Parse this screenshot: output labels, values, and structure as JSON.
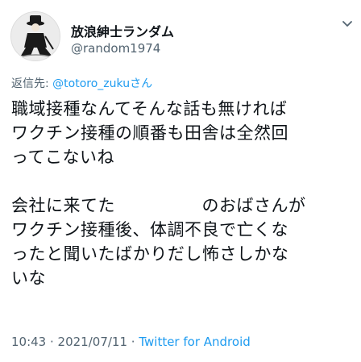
{
  "user": {
    "display_name": "放浪紳士ランダム",
    "handle": "@random1974"
  },
  "reply": {
    "prefix": "返信先: ",
    "mention": "@totoro_zuku",
    "suffix": "さん"
  },
  "tweet": {
    "paragraph1": [
      "職域接種なんてそんな話も無ければ",
      "ワクチン接種の順番も田舎は全然回",
      "ってこないね"
    ],
    "paragraph2": [
      "会社に来てた　　　　　のおばさんが",
      "ワクチン接種後、体調不良で亡くな",
      "ったと聞いたばかりだし怖さしかな",
      "いな"
    ]
  },
  "meta": {
    "time": "10:43",
    "separator1": " · ",
    "date": "2021/07/11",
    "separator2": " · ",
    "source": "Twitter for Android"
  },
  "icons": {
    "avatar": "avatar-illustration-icon",
    "more": "chevron-down-icon"
  },
  "colors": {
    "link": "#1d9bf0",
    "secondary_text": "#536471",
    "primary_text": "#0f1419"
  }
}
